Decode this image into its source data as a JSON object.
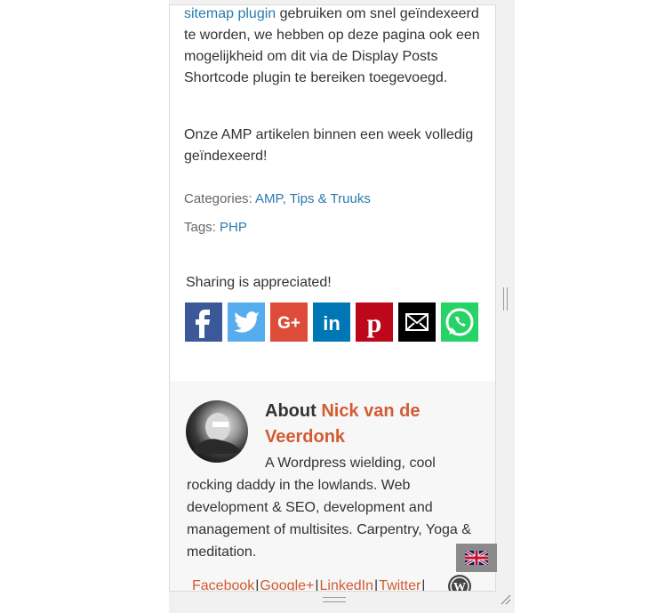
{
  "article": {
    "p1_link": "sitemap plugin",
    "p1_text": " gebruiken om snel geïndexeerd te worden, we hebben op deze pagina ook een mogelijkheid om dit via de Display Posts Shortcode plugin te bereiken toegevoegd.",
    "p2_text": "Onze AMP artikelen binnen een week volledig geïndexeerd!",
    "categories_label": "Categories: ",
    "categories": [
      "AMP",
      "Tips & Truuks"
    ],
    "categories_sep": ", ",
    "tags_label": "Tags: ",
    "tags": [
      "PHP"
    ]
  },
  "share": {
    "title": "Sharing is appreciated!",
    "buttons": [
      {
        "name": "facebook",
        "icon": "facebook-icon",
        "color": "#3b5998"
      },
      {
        "name": "twitter",
        "icon": "twitter-icon",
        "color": "#55acee"
      },
      {
        "name": "google-plus",
        "icon": "google-plus-icon",
        "color": "#dd4b39"
      },
      {
        "name": "linkedin",
        "icon": "linkedin-icon",
        "color": "#0077b5"
      },
      {
        "name": "pinterest",
        "icon": "pinterest-icon",
        "color": "#bd081c"
      },
      {
        "name": "email",
        "icon": "email-icon",
        "color": "#000000"
      },
      {
        "name": "whatsapp",
        "icon": "whatsapp-icon",
        "color": "#25d366"
      }
    ]
  },
  "author": {
    "about_label": "About ",
    "name": "Nick van de Veerdonk",
    "bio": "A Wordpress wielding, cool rocking daddy in the lowlands. Web development & SEO, development and management of multisites. Carpentry, Yoga & meditation.",
    "links": [
      "Facebook",
      "Google+",
      "LinkedIn",
      "Twitter"
    ],
    "link_sep": "|"
  },
  "colors": {
    "link_blue": "#2a7ab0",
    "author_orange": "#d25c32"
  },
  "language_flag": "uk-flag-icon"
}
